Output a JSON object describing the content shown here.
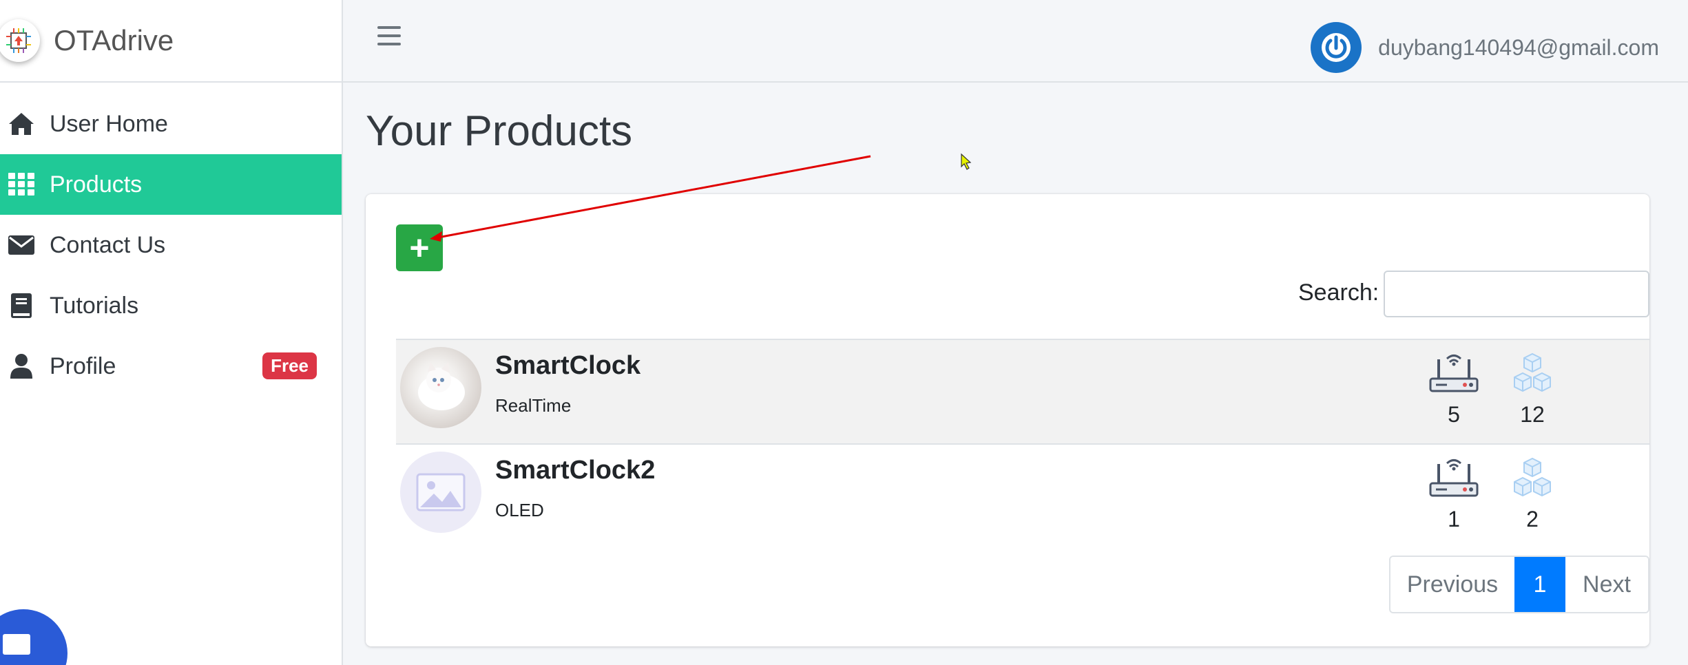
{
  "app": {
    "brand": "OTAdrive"
  },
  "sidebar": {
    "items": [
      {
        "label": "User Home",
        "icon": "home-icon"
      },
      {
        "label": "Products",
        "icon": "grid-icon",
        "active": true
      },
      {
        "label": "Contact Us",
        "icon": "envelope-icon"
      },
      {
        "label": "Tutorials",
        "icon": "book-icon"
      },
      {
        "label": "Profile",
        "icon": "user-icon",
        "badge": "Free"
      }
    ]
  },
  "header": {
    "user_email": "duybang140494@gmail.com"
  },
  "main": {
    "title": "Your Products",
    "add_label": "+",
    "search": {
      "label": "Search:",
      "value": "",
      "placeholder": ""
    },
    "products": [
      {
        "name": "SmartClock",
        "description": "RealTime",
        "devices": "5",
        "firmwares": "12"
      },
      {
        "name": "SmartClock2",
        "description": "OLED",
        "devices": "1",
        "firmwares": "2"
      }
    ],
    "pagination": {
      "previous": "Previous",
      "current": "1",
      "next": "Next"
    }
  },
  "colors": {
    "accent": "#20c997",
    "add_button": "#28a745",
    "page_active": "#007bff",
    "badge": "#dc3545",
    "annotation_arrow": "#e00000"
  }
}
